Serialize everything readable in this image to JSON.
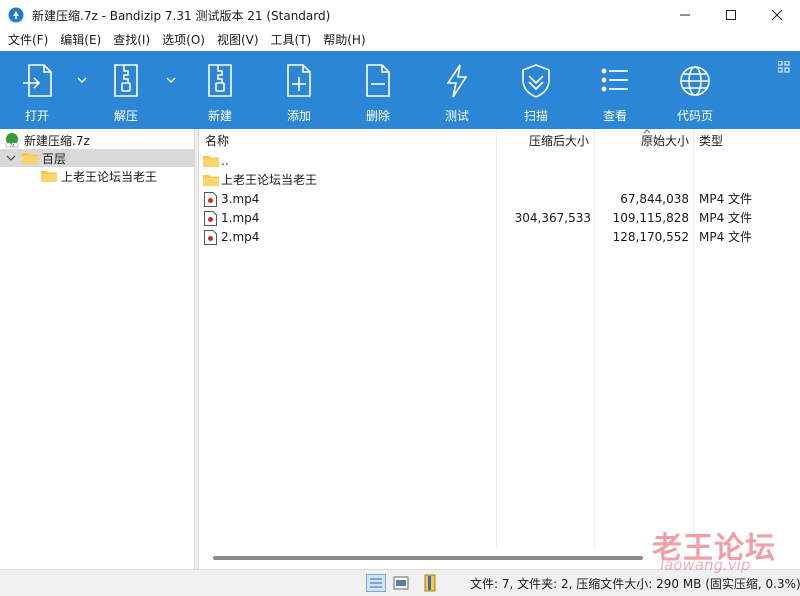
{
  "window": {
    "title": "新建压缩.7z - Bandizip 7.31 测试版本 21 (Standard)"
  },
  "menu": [
    "文件(F)",
    "编辑(E)",
    "查找(I)",
    "选项(O)",
    "视图(V)",
    "工具(T)",
    "帮助(H)"
  ],
  "toolbar": {
    "open": "打开",
    "extract": "解压",
    "new": "新建",
    "add": "添加",
    "delete": "删除",
    "test": "测试",
    "scan": "扫描",
    "view": "查看",
    "codepage": "代码页"
  },
  "tree": {
    "archive": "新建压缩.7z",
    "root_folder": "百层",
    "sub_folder": "上老王论坛当老王"
  },
  "columns": {
    "name": "名称",
    "packed": "压缩后大小",
    "original": "原始大小",
    "type": "类型"
  },
  "files": [
    {
      "name": "..",
      "packed": "",
      "original": "",
      "type": "",
      "kind": "folder"
    },
    {
      "name": "上老王论坛当老王",
      "packed": "",
      "original": "",
      "type": "",
      "kind": "folder"
    },
    {
      "name": "3.mp4",
      "packed": "",
      "original": "67,844,038",
      "type": "MP4 文件",
      "kind": "file"
    },
    {
      "name": "1.mp4",
      "packed": "304,367,533",
      "original": "109,115,828",
      "type": "MP4 文件",
      "kind": "file"
    },
    {
      "name": "2.mp4",
      "packed": "",
      "original": "128,170,552",
      "type": "MP4 文件",
      "kind": "file"
    }
  ],
  "status": {
    "text": "文件: 7, 文件夹: 2, 压缩文件大小: 290 MB (固实压缩, 0.3%)"
  },
  "watermark": {
    "main": "老王论坛",
    "sub": "laowang.vip"
  },
  "colors": {
    "toolbar_bg": "#2b86d6",
    "selection": "#d9d9d9",
    "folder": "#f6c94a"
  }
}
